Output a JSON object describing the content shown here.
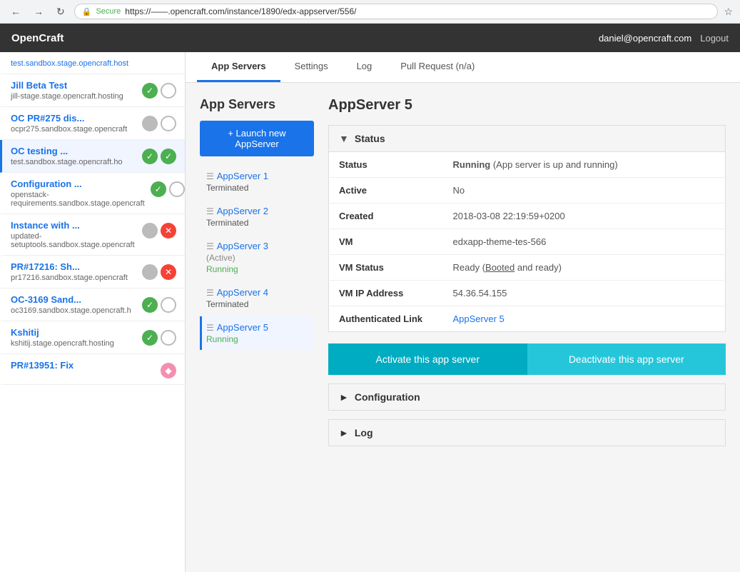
{
  "browser": {
    "url": "https://——.opencraft.com/instance/1890/edx-appserver/556/",
    "secure_text": "Secure"
  },
  "topnav": {
    "brand": "OpenCraft",
    "user": "daniel@opencraft.com",
    "logout": "Logout"
  },
  "sidebar": {
    "items": [
      {
        "name": "Jill Beta Test",
        "url": "jill-stage.stage.opencraft.hosting",
        "icons": [
          "green-check",
          "gray-outline"
        ],
        "active": false
      },
      {
        "name": "OC PR#275 dis...",
        "url": "ocpr275.sandbox.stage.opencraft",
        "icons": [
          "gray-filled",
          "gray-outline"
        ],
        "active": false
      },
      {
        "name": "OC testing ...",
        "url": "test.sandbox.stage.opencraft.ho",
        "icons": [
          "green-check",
          "green-check"
        ],
        "active": true
      },
      {
        "name": "Configuration ...",
        "url": "openstack-requirements.sandbox.stage.opencraft",
        "icons": [
          "green-check",
          "gray-outline"
        ],
        "active": false
      },
      {
        "name": "Instance with ...",
        "url": "updated-setuptools.sandbox.stage.opencraft",
        "icons": [
          "gray-filled",
          "red-x"
        ],
        "active": false
      },
      {
        "name": "PR#17216: Sh...",
        "url": "pr17216.sandbox.stage.opencraft",
        "icons": [
          "gray-filled",
          "red-x"
        ],
        "active": false
      },
      {
        "name": "OC-3169 Sand...",
        "url": "oc3169.sandbox.stage.opencraft.h",
        "icons": [
          "green-check",
          "gray-outline"
        ],
        "active": false
      },
      {
        "name": "Kshitij",
        "url": "kshitij.stage.opencraft.hosting",
        "icons": [
          "green-check",
          "gray-outline"
        ],
        "active": false
      },
      {
        "name": "PR#13951: Fix",
        "url": "",
        "icons": [
          "pink-partial"
        ],
        "active": false
      }
    ],
    "top_url": "test.sandbox.stage.opencraft.host"
  },
  "tabs": {
    "items": [
      "App Servers",
      "Settings",
      "Log",
      "Pull Request (n/a)"
    ],
    "active": "App Servers"
  },
  "appservers_panel": {
    "title": "App Servers",
    "launch_button": "+ Launch new AppServer",
    "servers": [
      {
        "name": "AppServer 1",
        "status": "Terminated",
        "active_label": null,
        "selected": false
      },
      {
        "name": "AppServer 2",
        "status": "Terminated",
        "active_label": null,
        "selected": false
      },
      {
        "name": "AppServer 3",
        "status": "Running",
        "active_label": "(Active)",
        "selected": false
      },
      {
        "name": "AppServer 4",
        "status": "Terminated",
        "active_label": null,
        "selected": false
      },
      {
        "name": "AppServer 5",
        "status": "Running",
        "active_label": null,
        "selected": true
      }
    ]
  },
  "appserver_detail": {
    "title": "AppServer 5",
    "status_section": "Status",
    "fields": [
      {
        "label": "Status",
        "value": "Running",
        "value_extra": "(App server is up and running)"
      },
      {
        "label": "Active",
        "value": "No"
      },
      {
        "label": "Created",
        "value": "2018-03-08 22:19:59+0200"
      },
      {
        "label": "VM",
        "value": "edxapp-theme-tes-566"
      },
      {
        "label": "VM Status",
        "value": "Ready",
        "value_extra": "Booted",
        "value_after": "and ready)"
      },
      {
        "label": "VM IP Address",
        "value": "54.36.54.155"
      },
      {
        "label": "Authenticated Link",
        "value": "AppServer 5",
        "is_link": true
      }
    ],
    "activate_btn": "Activate this app server",
    "deactivate_btn": "Deactivate this app server",
    "configuration_section": "Configuration",
    "log_section": "Log"
  }
}
